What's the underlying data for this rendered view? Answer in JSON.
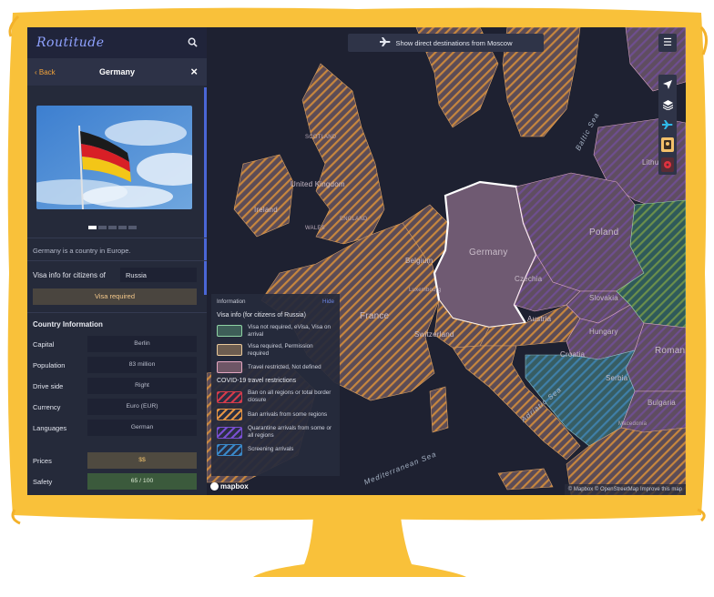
{
  "app": {
    "logo": "Routitude"
  },
  "sidebar": {
    "back_label": "‹ Back",
    "title": "Germany",
    "description": "Germany is a country in Europe.",
    "visa_label": "Visa info for citizens of",
    "visa_country": "Russia",
    "visa_status": "Visa required",
    "country_info_title": "Country Information",
    "info": [
      {
        "key": "Capital",
        "value": "Berlin"
      },
      {
        "key": "Population",
        "value": "83 million"
      },
      {
        "key": "Drive side",
        "value": "Right"
      },
      {
        "key": "Currency",
        "value": "Euro (EUR)"
      },
      {
        "key": "Languages",
        "value": "German"
      }
    ],
    "prices_label": "Prices",
    "prices_value": "$$",
    "safety_label": "Safety",
    "safety_value": "65 / 100"
  },
  "map": {
    "banner": "Show direct destinations from Moscow",
    "labels": {
      "united_kingdom": "United Kingdom",
      "ireland": "Ireland",
      "belgium": "Belgium",
      "luxembourg": "Luxembourg",
      "france": "France",
      "switzerland": "Switzerland",
      "germany": "Germany",
      "czechia": "Czechia",
      "austria": "Austria",
      "poland": "Poland",
      "slovakia": "Slovakia",
      "hungary": "Hungary",
      "romania": "Romania",
      "croatia": "Croatia",
      "serbia": "Serbia",
      "bulgaria": "Bulgaria",
      "macedonia": "Macedonia",
      "lithuania": "Lithuania",
      "scotland": "SCOTLAND",
      "wales": "WALES",
      "england": "ENGLAND",
      "baltic_sea": "Baltic Sea",
      "adriatic_sea": "Adriatic Sea",
      "mediterranean_sea": "Mediterranean Sea"
    },
    "attribution": "© Mapbox © OpenStreetMap  Improve this map",
    "mapbox_label": "mapbox"
  },
  "legend": {
    "title": "Information",
    "hide": "Hide",
    "visa_group": "Visa info (for citizens of Russia)",
    "visa_items": [
      {
        "label": "Visa not required, eVisa, Visa on arrival",
        "color": "#3e5e58",
        "border": "#8fd2a4"
      },
      {
        "label": "Visa required, Permission required",
        "color": "#6d5d50",
        "border": "#e9c99a"
      },
      {
        "label": "Travel restricted, Not defined",
        "color": "#6e5666",
        "border": "#e3a6c0"
      }
    ],
    "covid_group": "COVID-19 travel restrictions",
    "covid_items": [
      {
        "label": "Ban on all regions or total border closure",
        "color": "#d43b4b"
      },
      {
        "label": "Ban arrivals from some regions",
        "color": "#e59544"
      },
      {
        "label": "Quarantine arrivals from some or all regions",
        "color": "#7a4fd3"
      },
      {
        "label": "Screening arrivals",
        "color": "#3a88c8"
      }
    ]
  },
  "colors": {
    "frame": "#f9c13a",
    "accent": "#f2a33a",
    "brand": "#8fa2ff"
  }
}
